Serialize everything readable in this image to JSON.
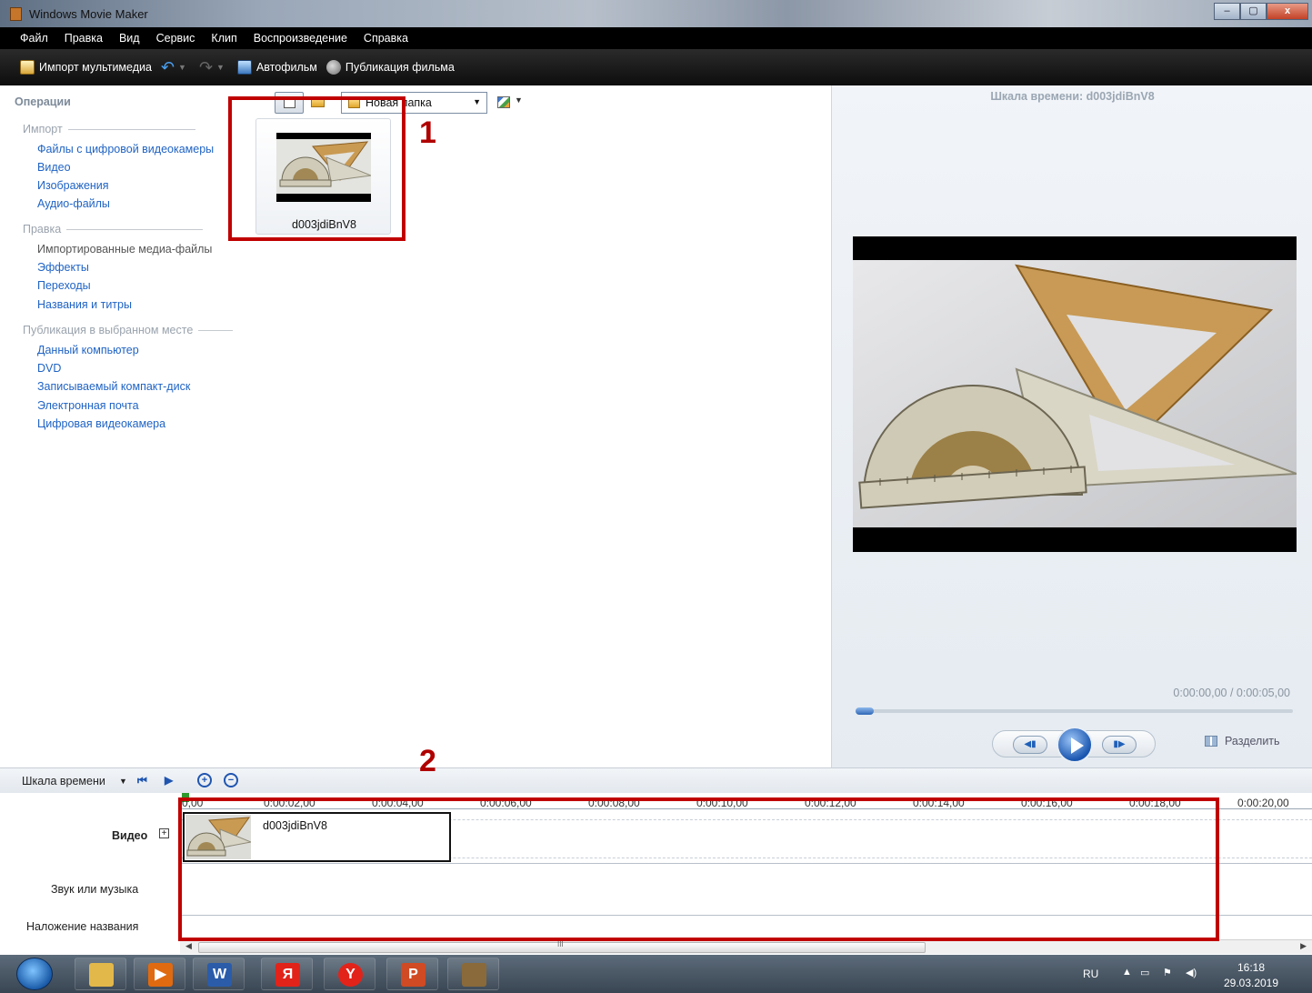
{
  "window": {
    "title": "Windows Movie Maker",
    "controls": [
      "–",
      "▢",
      "x"
    ]
  },
  "menu": [
    "Файл",
    "Правка",
    "Вид",
    "Сервис",
    "Клип",
    "Воспроизведение",
    "Справка"
  ],
  "toolbar": {
    "import_label": "Импорт мультимедиа",
    "automovie_label": "Автофильм",
    "publish_label": "Публикация фильма"
  },
  "tasks": {
    "header": "Операции",
    "import_section": "Импорт",
    "import_links": [
      "Файлы с цифровой видеокамеры",
      "Видео",
      "Изображения",
      "Аудио-файлы"
    ],
    "edit_section": "Правка",
    "edit_links": [
      "Импортированные медиа-файлы",
      "Эффекты",
      "Переходы",
      "Названия и титры"
    ],
    "publish_section": "Публикация в выбранном месте",
    "publish_links": [
      "Данный компьютер",
      "DVD",
      "Записываемый компакт-диск",
      "Электронная почта",
      "Цифровая видеокамера"
    ]
  },
  "collection": {
    "folder_select": "Новая папка",
    "clip_name": "d003jdiBnV8"
  },
  "annotations": {
    "mark1": "1",
    "mark2": "2",
    "color": "#c00000"
  },
  "preview": {
    "title": "Шкала времени: d003jdiBnV8",
    "time": "0:00:00,00 / 0:00:05,00",
    "split_label": "Разделить"
  },
  "timeline": {
    "view_label": "Шкала времени",
    "ticks": [
      "0,00",
      "0:00:02,00",
      "0:00:04,00",
      "0:00:06,00",
      "0:00:08,00",
      "0:00:10,00",
      "0:00:12,00",
      "0:00:14,00",
      "0:00:16,00",
      "0:00:18,00",
      "0:00:20,00"
    ],
    "video_label": "Видео",
    "audio_label": "Звук или музыка",
    "title_overlay_label": "Наложение названия",
    "clip_name": "d003jdiBnV8",
    "scroll_grip": "III"
  },
  "taskbar": {
    "lang": "RU",
    "time": "16:18",
    "date": "29.03.2019",
    "apps": [
      {
        "icon": "file-explorer-icon",
        "color": "#e3b84a",
        "glyph": ""
      },
      {
        "icon": "media-player-icon",
        "color": "#e06a10",
        "glyph": "▶"
      },
      {
        "icon": "word-icon",
        "color": "#2a5caa",
        "glyph": "W"
      },
      {
        "icon": "yandex-icon",
        "color": "#e2231a",
        "glyph": "Я"
      },
      {
        "icon": "yandex-browser-icon",
        "color": "#e2231a",
        "glyph": "Y"
      },
      {
        "icon": "powerpoint-icon",
        "color": "#d04a23",
        "glyph": "P"
      },
      {
        "icon": "movie-maker-icon",
        "color": "#8a6a3a",
        "glyph": ""
      }
    ]
  }
}
